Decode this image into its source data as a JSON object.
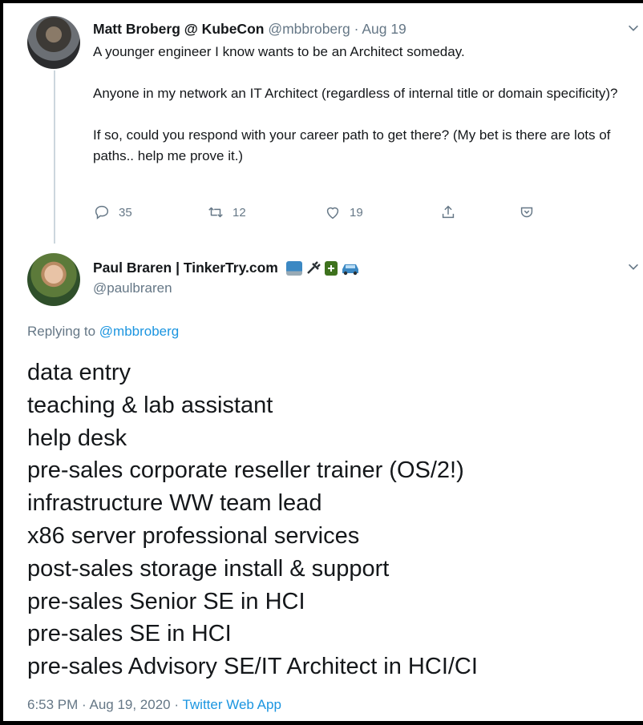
{
  "tweet1": {
    "name": "Matt Broberg @ KubeCon",
    "handle": "@mbbroberg",
    "date_sep": " · ",
    "date": "Aug 19",
    "paragraphs": [
      "A younger engineer I know wants to be an Architect someday.",
      "Anyone in my network an IT Architect (regardless of internal title or domain specificity)?",
      "If so, could you respond with your career path to get there? (My bet is there are lots of paths.. help me prove it.)"
    ],
    "actions": {
      "reply_count": "35",
      "retweet_count": "12",
      "like_count": "19"
    }
  },
  "tweet2": {
    "name": "Paul Braren | TinkerTry.com",
    "name_emojis": [
      "laptop-icon",
      "electric-plug-icon",
      "battery-icon",
      "car-icon"
    ],
    "handle": "@paulbraren",
    "replying_prefix": "Replying to ",
    "replying_handle": "@mbbroberg",
    "lines": [
      "data entry",
      "teaching & lab assistant",
      "help desk",
      "pre-sales corporate reseller trainer (OS/2!)",
      "infrastructure WW team lead",
      "x86 server professional services",
      "post-sales storage install & support",
      "pre-sales Senior SE in HCI",
      "pre-sales SE in HCI",
      "pre-sales Advisory SE/IT Architect in HCI/CI"
    ],
    "timestamp": "6:53 PM · Aug 19, 2020 · ",
    "source": "Twitter Web App"
  },
  "colors": {
    "text": "#14171a",
    "secondary": "#657786",
    "link": "#1b95e0",
    "thread_line": "#ccd6dd"
  }
}
